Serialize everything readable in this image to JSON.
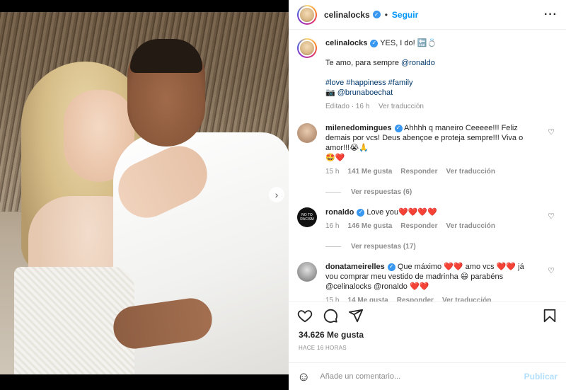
{
  "post": {
    "author": "celinalocks",
    "follow_label": "Seguir",
    "more_icon": "more-options-icon",
    "photo": {
      "current_slide": 1,
      "total_slides": 2
    }
  },
  "caption": {
    "username": "celinalocks",
    "line1": "YES, I do! 🔚💍",
    "line2_prefix": "Te amo, para sempre ",
    "line2_mention": "@ronaldo",
    "hashtags": "#love #happiness #family",
    "camera": "📷",
    "credit": "@brunaboechat",
    "edited": "Editado · 16 h",
    "see_translation": "Ver traducción"
  },
  "comments": [
    {
      "username": "milenedomingues",
      "text": " Ahhhh q maneiro Ceeeee!!! Feliz demais por vcs! Deus abençoe e proteja sempre!!! Viva o amor!!!😭🙏",
      "emoji_line": "🤩❤️",
      "time": "15 h",
      "likes": "141 Me gusta",
      "reply": "Responder",
      "translate": "Ver traducción",
      "view_replies": "Ver respuestas (6)",
      "avatar_color": "#c9a98a"
    },
    {
      "username": "ronaldo",
      "text": " Love you❤️❤️❤️❤️",
      "time": "16 h",
      "likes": "146 Me gusta",
      "reply": "Responder",
      "translate": "Ver traducción",
      "view_replies": "Ver respuestas (17)",
      "avatar_text": "NO TO RACISM"
    },
    {
      "username": "donatameirelles",
      "text": " Que máximo ❤️❤️ amo vcs ❤️❤️ já vou comprar meu vestido de madrinha 😄 parabéns @celinalocks @ronaldo ❤️❤️",
      "time": "15 h",
      "likes": "14 Me gusta",
      "reply": "Responder",
      "translate": "Ver traducción",
      "avatar_color": "#8c8c8c"
    }
  ],
  "footer": {
    "likes": "34.626 Me gusta",
    "timestamp": "HACE 16 HORAS",
    "comment_placeholder": "Añade un comentario...",
    "publish_label": "Publicar"
  },
  "colors": {
    "accent": "#0095f6",
    "verified": "#3897f0",
    "heart": "#ed4956",
    "muted": "#8e8e8e"
  }
}
